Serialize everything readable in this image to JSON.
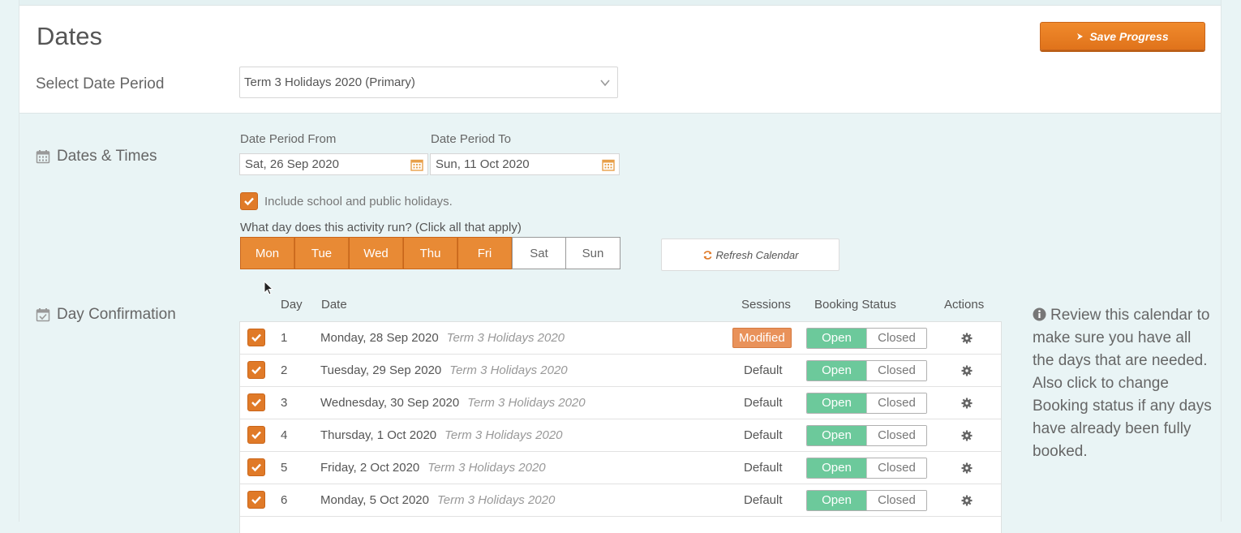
{
  "header": {
    "title": "Dates",
    "save_label": "Save Progress",
    "select_period_label": "Select Date Period",
    "select_period_value": "Term 3 Holidays 2020 (Primary)"
  },
  "dates_times": {
    "section_label": "Dates & Times",
    "from_label": "Date Period From",
    "from_value": "Sat, 26 Sep 2020",
    "to_label": "Date Period To",
    "to_value": "Sun, 11 Oct 2020",
    "include_holidays_label": "Include school and public holidays.",
    "include_holidays_checked": true,
    "question": "What day does this activity run? (Click all that apply)",
    "days": [
      {
        "label": "Mon",
        "selected": true
      },
      {
        "label": "Tue",
        "selected": true
      },
      {
        "label": "Wed",
        "selected": true
      },
      {
        "label": "Thu",
        "selected": true
      },
      {
        "label": "Fri",
        "selected": true
      },
      {
        "label": "Sat",
        "selected": false
      },
      {
        "label": "Sun",
        "selected": false
      }
    ],
    "refresh_label": "Refresh Calendar"
  },
  "day_confirmation": {
    "section_label": "Day Confirmation",
    "columns": {
      "day": "Day",
      "date": "Date",
      "sessions": "Sessions",
      "booking_status": "Booking Status",
      "actions": "Actions"
    },
    "rows": [
      {
        "day": "1",
        "date": "Monday, 28 Sep 2020",
        "term": "Term 3 Holidays 2020",
        "sessions": "Modified",
        "open": "Open",
        "closed": "Closed"
      },
      {
        "day": "2",
        "date": "Tuesday, 29 Sep 2020",
        "term": "Term 3 Holidays 2020",
        "sessions": "Default",
        "open": "Open",
        "closed": "Closed"
      },
      {
        "day": "3",
        "date": "Wednesday, 30 Sep 2020",
        "term": "Term 3 Holidays 2020",
        "sessions": "Default",
        "open": "Open",
        "closed": "Closed"
      },
      {
        "day": "4",
        "date": "Thursday, 1 Oct 2020",
        "term": "Term 3 Holidays 2020",
        "sessions": "Default",
        "open": "Open",
        "closed": "Closed"
      },
      {
        "day": "5",
        "date": "Friday, 2 Oct 2020",
        "term": "Term 3 Holidays 2020",
        "sessions": "Default",
        "open": "Open",
        "closed": "Closed"
      },
      {
        "day": "6",
        "date": "Monday, 5 Oct 2020",
        "term": "Term 3 Holidays 2020",
        "sessions": "Default",
        "open": "Open",
        "closed": "Closed"
      }
    ],
    "info_text": "Review this calendar to make sure you have all the days that are needed. Also click to change Booking status if any days have already been fully booked."
  },
  "colors": {
    "accent_orange": "#e88a35",
    "open_green": "#6cc99b",
    "panel_bg": "#e9f4f5"
  },
  "icons": [
    "save-arrow-icon",
    "chevron-down-icon",
    "calendar-icon",
    "calendar-check-icon",
    "checkmark-icon",
    "refresh-icon",
    "gear-icon",
    "info-icon",
    "mouse-cursor"
  ]
}
